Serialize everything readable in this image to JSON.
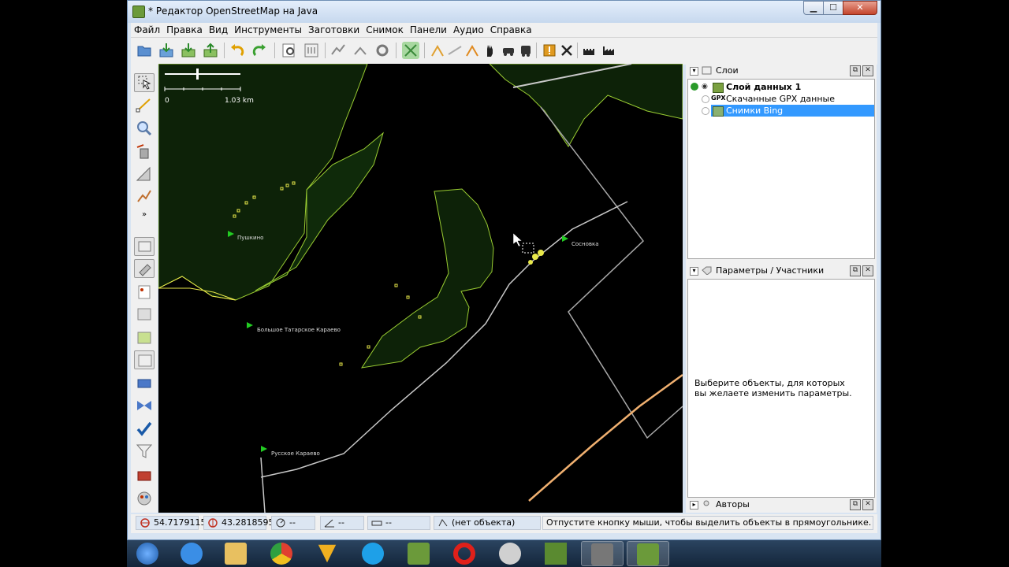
{
  "window": {
    "title": "* Редактор OpenStreetMap на Java"
  },
  "window_buttons": {
    "minimize": "▁",
    "maximize": "☐",
    "close": "✕"
  },
  "menu": [
    "Файл",
    "Правка",
    "Вид",
    "Инструменты",
    "Заготовки",
    "Снимок",
    "Панели",
    "Аудио",
    "Справка"
  ],
  "map": {
    "scale_left": "0",
    "scale_right": "1.03 km",
    "places": [
      "Пушкино",
      "Сосновка",
      "Большое Татарское Караево",
      "Русское Караево"
    ],
    "colors": {
      "land": "#0d2208",
      "boundary": "#9acd32",
      "node": "#e8e84a",
      "road": "#c8c8c8",
      "highway": "#f0b070"
    }
  },
  "layers_panel": {
    "title": "Слои",
    "items": [
      {
        "name": "Слой данных 1",
        "bold": true
      },
      {
        "prefix": "GPX",
        "name": "Скачанные GPX данные"
      },
      {
        "name": "Снимки Bing",
        "selected": true
      }
    ]
  },
  "props_panel": {
    "title": "Параметры / Участники",
    "hint": "Выберите объекты, для которых вы желаете изменить параметры."
  },
  "authors_panel": {
    "title": "Авторы"
  },
  "status": {
    "lat": "54.7179115",
    "lon": "43.2818595",
    "heading": "--",
    "angle": "--",
    "length": "--",
    "object": "(нет объекта)",
    "message": "Отпустите кнопку мыши, чтобы выделить объекты в прямоугольнике."
  },
  "taskbar_icons": [
    "start-orb-icon",
    "ie-icon",
    "explorer-icon",
    "chrome-icon",
    "winamp-icon",
    "skype-icon",
    "josm-icon",
    "opera-icon",
    "paint-icon",
    "minecraft-icon",
    "usb-icon",
    "josm-icon"
  ]
}
